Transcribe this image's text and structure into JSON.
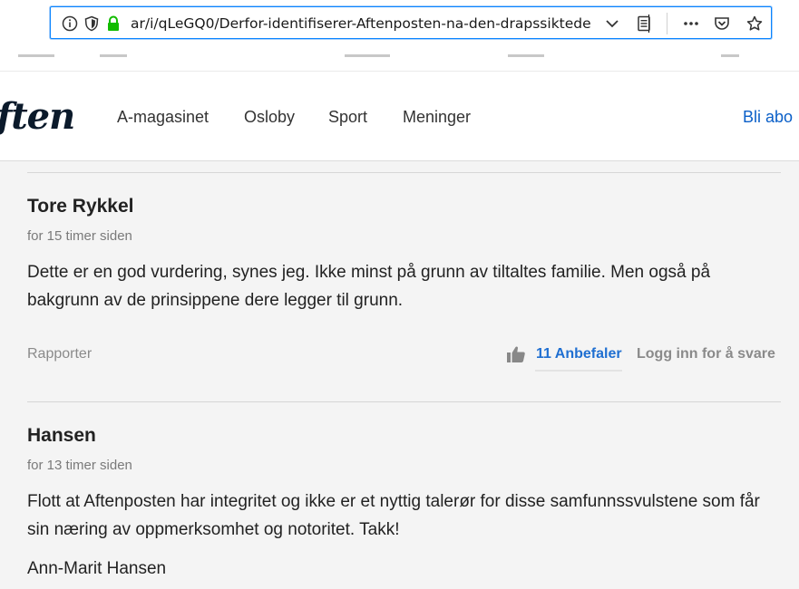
{
  "browser": {
    "url": "…ar/i/qLeGQ0/Derfor-identifiserer-Aftenposten-na-den-drapssiktede",
    "url_visible": "ar/i/qLeGQ0/Derfor-identifiserer-Aftenposten-na-den-drapssiktede",
    "icons": [
      "info-icon",
      "tracking-shield-icon",
      "lock-icon",
      "dropdown-icon",
      "reader-view-icon",
      "more-icon",
      "pocket-icon",
      "bookmark-star-icon"
    ]
  },
  "site": {
    "logo": "ften",
    "nav": [
      "A-magasinet",
      "Osloby",
      "Sport",
      "Meninger"
    ],
    "subscribe": "Bli abo"
  },
  "comments": [
    {
      "author": "Tore Rykkel",
      "time": "for 15 timer siden",
      "body": "Dette er en god vurdering, synes jeg. Ikke minst på grunn av tiltaltes familie. Men også på bakgrunn av de prinsippene dere legger til grunn.",
      "report": "Rapporter",
      "likes": "11 Anbefaler",
      "reply": "Logg inn for å svare"
    },
    {
      "author": "Hansen",
      "time": "for 13 timer siden",
      "body": "Flott at Aftenposten har integritet og ikke er et nyttig talerør for disse samfunnssvulstene som får sin næring av oppmerksomhet og notoritet. Takk!",
      "signature": "Ann-Marit Hansen"
    }
  ],
  "colors": {
    "accent_link": "#1f6fd1",
    "subscribe": "#0a5fc8",
    "urlbar_border": "#0a84ff",
    "content_bg": "#f4f4f4"
  }
}
